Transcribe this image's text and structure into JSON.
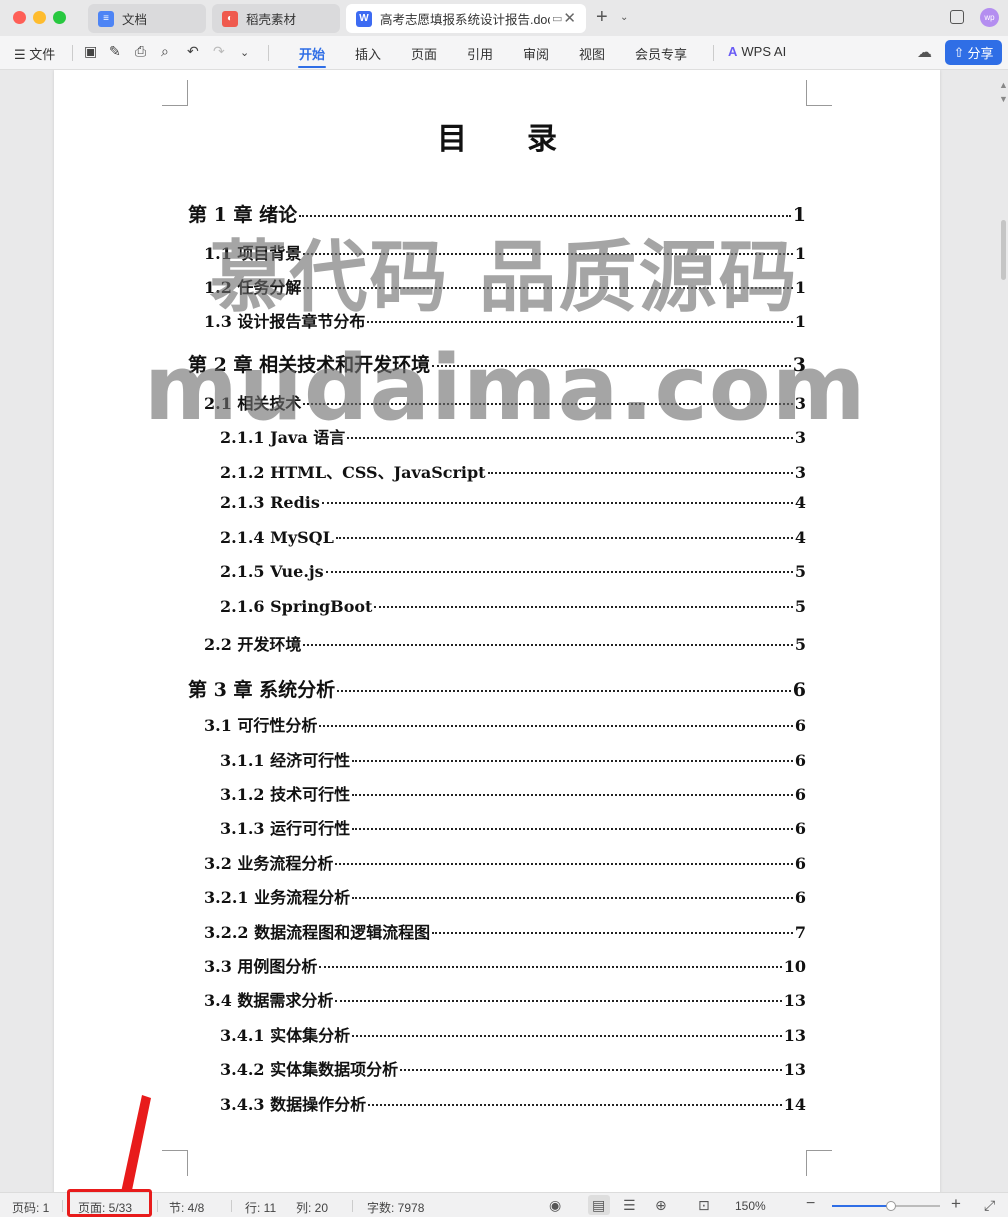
{
  "tabs": [
    {
      "label": "文档",
      "icon": "doc-icon"
    },
    {
      "label": "稻壳素材",
      "icon": "daoke-icon"
    },
    {
      "label": "高考志愿填报系统设计报告.docx",
      "icon": "word-icon"
    }
  ],
  "toolbar": {
    "file_label": "文件",
    "ribbon_tabs": [
      "开始",
      "插入",
      "页面",
      "引用",
      "审阅",
      "视图",
      "会员专享"
    ],
    "ai_label": "WPS AI",
    "share_label": "分享"
  },
  "document": {
    "title": "目录",
    "toc": [
      {
        "label": "第 1 章  绪论",
        "page": "1",
        "level": 1
      },
      {
        "label": "1.1  项目背景",
        "page": "1",
        "level": 2
      },
      {
        "label": "1.2  任务分解",
        "page": "1",
        "level": 2
      },
      {
        "label": "1.3  设计报告章节分布",
        "page": "1",
        "level": 2
      },
      {
        "label": "第 2 章  相关技术和开发环境",
        "page": "3",
        "level": 1
      },
      {
        "label": "2.1  相关技术",
        "page": "3",
        "level": 2
      },
      {
        "label": "2.1.1 Java 语言",
        "page": "3",
        "level": 3
      },
      {
        "label": "2.1.2 HTML、CSS、JavaScript",
        "page": "3",
        "level": 3
      },
      {
        "label": "2.1.3 Redis",
        "page": "4",
        "level": 3
      },
      {
        "label": "2.1.4 MySQL",
        "page": "4",
        "level": 3
      },
      {
        "label": "2.1.5 Vue.js",
        "page": "5",
        "level": 3
      },
      {
        "label": "2.1.6 SpringBoot",
        "page": "5",
        "level": 3
      },
      {
        "label": "2.2  开发环境",
        "page": "5",
        "level": 2
      },
      {
        "label": "第 3 章  系统分析",
        "page": "6",
        "level": 1
      },
      {
        "label": "3.1  可行性分析",
        "page": "6",
        "level": 2
      },
      {
        "label": "3.1.1  经济可行性",
        "page": "6",
        "level": 3
      },
      {
        "label": "3.1.2  技术可行性",
        "page": "6",
        "level": 3
      },
      {
        "label": "3.1.3  运行可行性",
        "page": "6",
        "level": 3
      },
      {
        "label": "3.2  业务流程分析",
        "page": "6",
        "level": 2
      },
      {
        "label": "3.2.1  业务流程分析",
        "page": "6",
        "level": 2
      },
      {
        "label": "3.2.2  数据流程图和逻辑流程图",
        "page": "7",
        "level": 2
      },
      {
        "label": "3.3  用例图分析",
        "page": "10",
        "level": 2
      },
      {
        "label": "3.4  数据需求分析",
        "page": "13",
        "level": 2
      },
      {
        "label": "3.4.1  实体集分析",
        "page": "13",
        "level": 3
      },
      {
        "label": "3.4.2  实体集数据项分析",
        "page": "13",
        "level": 3
      },
      {
        "label": "3.4.3  数据操作分析",
        "page": "14",
        "level": 3
      }
    ],
    "watermark_line1": "慕代码 品质源码",
    "watermark_line2": "mudaima.com"
  },
  "statusbar": {
    "page_num": "页码: 1",
    "pages": "页面: 5/33",
    "section": "节: 4/8",
    "row": "行: 11",
    "col": "列: 20",
    "words": "字数: 7978",
    "zoom": "150%",
    "zoom_fraction": 0.55
  },
  "colors": {
    "accent": "#2f6ee6",
    "highlight": "#e81b1b"
  }
}
